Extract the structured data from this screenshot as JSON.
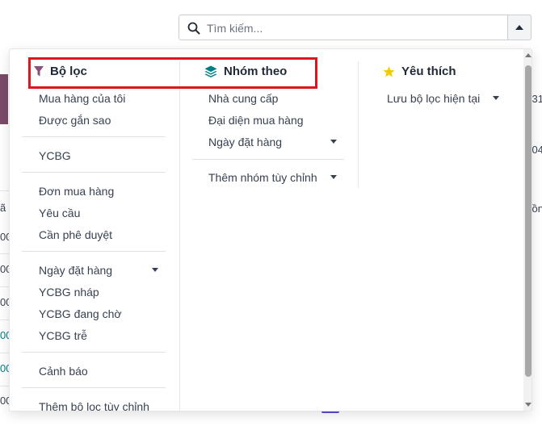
{
  "search": {
    "placeholder": "Tìm kiếm..."
  },
  "filters": {
    "header": "Bộ lọc",
    "groups": [
      [
        "Mua hàng của tôi",
        "Được gắn sao"
      ],
      [
        "YCBG"
      ],
      [
        "Đơn mua hàng",
        "Yêu cầu",
        "Cần phê duyệt"
      ],
      [
        "Ngày đặt hàng",
        "YCBG nháp",
        "YCBG đang chờ",
        "YCBG trễ"
      ],
      [
        "Cảnh báo"
      ],
      [
        "Thêm bộ lọc tùy chỉnh"
      ]
    ]
  },
  "groupby": {
    "header": "Nhóm theo",
    "items": [
      "Nhà cung cấp",
      "Đại diện mua hàng",
      "Ngày đặt hàng"
    ],
    "custom": "Thêm nhóm tùy chỉnh"
  },
  "favorites": {
    "header": "Yêu thích",
    "save_current": "Lưu bộ lọc hiện tại"
  },
  "background": {
    "left_glyphs": [
      "ã",
      "00",
      "00",
      "00",
      "00",
      "00",
      "00"
    ],
    "right_texts": [
      "31",
      "04",
      "ồn"
    ]
  },
  "colors": {
    "filter_icon": "#8a4f7d",
    "groupby_icon": "#017e84",
    "star_icon": "#f3cc00",
    "highlight": "#e0141e"
  }
}
